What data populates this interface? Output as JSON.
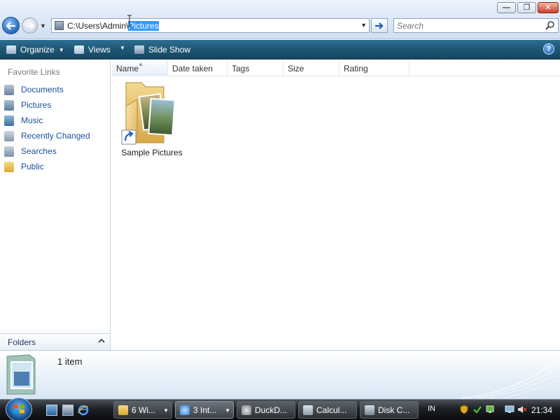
{
  "window": {
    "caption_buttons": {
      "minimize": "—",
      "maximize": "❐",
      "close": "✕"
    }
  },
  "address_bar": {
    "path_prefix": "C:\\Users\\Admin\\",
    "path_selected": "Pictures",
    "search_placeholder": "Search"
  },
  "command_bar": {
    "organize_label": "Organize",
    "views_label": "Views",
    "slideshow_label": "Slide Show",
    "help_label": "?"
  },
  "nav_pane": {
    "header": "Favorite Links",
    "links": [
      {
        "label": "Documents",
        "icon": "documents-icon"
      },
      {
        "label": "Pictures",
        "icon": "pictures-icon"
      },
      {
        "label": "Music",
        "icon": "music-icon"
      },
      {
        "label": "Recently Changed",
        "icon": "recent-icon"
      },
      {
        "label": "Searches",
        "icon": "searches-icon"
      },
      {
        "label": "Public",
        "icon": "public-folder-icon"
      }
    ],
    "folders_label": "Folders"
  },
  "columns": [
    "Name",
    "Date taken",
    "Tags",
    "Size",
    "Rating"
  ],
  "items": [
    {
      "label": "Sample Pictures",
      "icon": "shortcut-folder-icon"
    }
  ],
  "details": {
    "item_count": "1 item"
  },
  "taskbar": {
    "tasks": [
      {
        "label": "6 Wi...",
        "icon": "explorer-folder-icon"
      },
      {
        "label": "3 Int...",
        "icon": "internet-explorer-icon"
      },
      {
        "label": "DuckD...",
        "icon": "duckduckgo-icon"
      },
      {
        "label": "Calcul...",
        "icon": "calculator-icon"
      },
      {
        "label": "Disk C...",
        "icon": "disk-cleanup-icon"
      }
    ],
    "language": "IN",
    "clock": "21:34"
  },
  "colors": {
    "command_bar": "#1f5877",
    "link_text": "#1a4f9c",
    "selection": "#3399ff",
    "taskbar": "#1c1f23"
  }
}
